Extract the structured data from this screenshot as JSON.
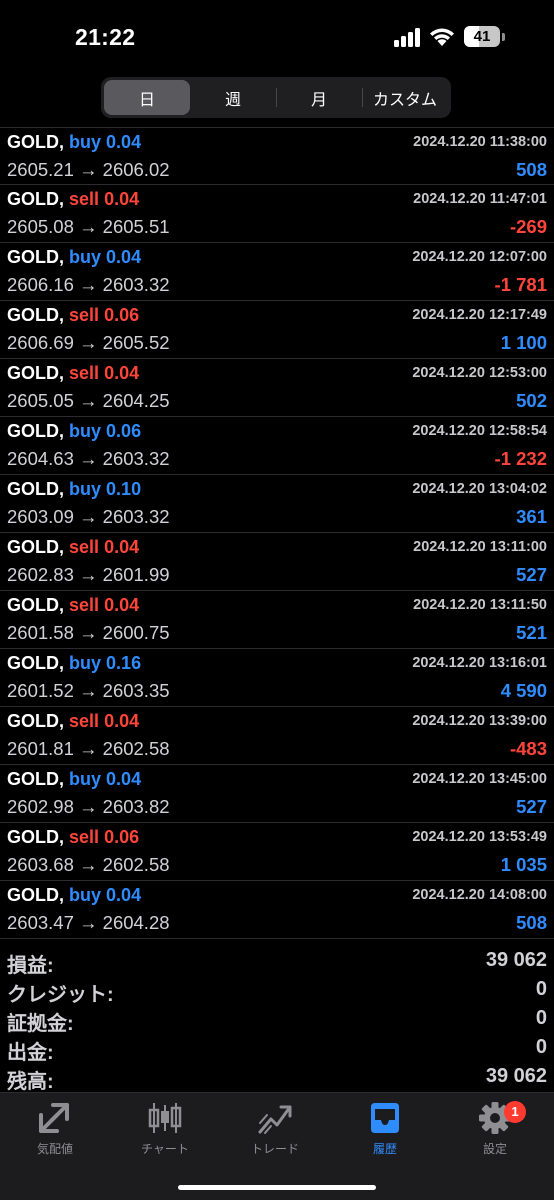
{
  "status": {
    "time": "21:22",
    "battery": "41",
    "battery_level": 0.41
  },
  "period_tabs": [
    {
      "label": "日",
      "active": true
    },
    {
      "label": "週",
      "active": false
    },
    {
      "label": "月",
      "active": false
    },
    {
      "label": "カスタム",
      "active": false
    }
  ],
  "deals": [
    {
      "symbol": "GOLD,",
      "side": "buy",
      "volume": "0.04",
      "prices": "2605.21 → 2606.02",
      "time": "2024.12.20 11:38:00",
      "profit": "508"
    },
    {
      "symbol": "GOLD,",
      "side": "sell",
      "volume": "0.04",
      "prices": "2605.08 → 2605.51",
      "time": "2024.12.20 11:47:01",
      "profit": "-269"
    },
    {
      "symbol": "GOLD,",
      "side": "buy",
      "volume": "0.04",
      "prices": "2606.16 → 2603.32",
      "time": "2024.12.20 12:07:00",
      "profit": "-1 781"
    },
    {
      "symbol": "GOLD,",
      "side": "sell",
      "volume": "0.06",
      "prices": "2606.69 → 2605.52",
      "time": "2024.12.20 12:17:49",
      "profit": "1 100"
    },
    {
      "symbol": "GOLD,",
      "side": "sell",
      "volume": "0.04",
      "prices": "2605.05 → 2604.25",
      "time": "2024.12.20 12:53:00",
      "profit": "502"
    },
    {
      "symbol": "GOLD,",
      "side": "buy",
      "volume": "0.06",
      "prices": "2604.63 → 2603.32",
      "time": "2024.12.20 12:58:54",
      "profit": "-1 232"
    },
    {
      "symbol": "GOLD,",
      "side": "buy",
      "volume": "0.10",
      "prices": "2603.09 → 2603.32",
      "time": "2024.12.20 13:04:02",
      "profit": "361"
    },
    {
      "symbol": "GOLD,",
      "side": "sell",
      "volume": "0.04",
      "prices": "2602.83 → 2601.99",
      "time": "2024.12.20 13:11:00",
      "profit": "527"
    },
    {
      "symbol": "GOLD,",
      "side": "sell",
      "volume": "0.04",
      "prices": "2601.58 → 2600.75",
      "time": "2024.12.20 13:11:50",
      "profit": "521"
    },
    {
      "symbol": "GOLD,",
      "side": "buy",
      "volume": "0.16",
      "prices": "2601.52 → 2603.35",
      "time": "2024.12.20 13:16:01",
      "profit": "4 590"
    },
    {
      "symbol": "GOLD,",
      "side": "sell",
      "volume": "0.04",
      "prices": "2601.81 → 2602.58",
      "time": "2024.12.20 13:39:00",
      "profit": "-483"
    },
    {
      "symbol": "GOLD,",
      "side": "buy",
      "volume": "0.04",
      "prices": "2602.98 → 2603.82",
      "time": "2024.12.20 13:45:00",
      "profit": "527"
    },
    {
      "symbol": "GOLD,",
      "side": "sell",
      "volume": "0.06",
      "prices": "2603.68 → 2602.58",
      "time": "2024.12.20 13:53:49",
      "profit": "1 035"
    },
    {
      "symbol": "GOLD,",
      "side": "buy",
      "volume": "0.04",
      "prices": "2603.47 → 2604.28",
      "time": "2024.12.20 14:08:00",
      "profit": "508"
    }
  ],
  "summary": [
    {
      "label": "損益:",
      "value": "39 062"
    },
    {
      "label": "クレジット:",
      "value": "0"
    },
    {
      "label": "証拠金:",
      "value": "0"
    },
    {
      "label": "出金:",
      "value": "0"
    },
    {
      "label": "残高:",
      "value": "39 062"
    }
  ],
  "tabbar": [
    {
      "label": "気配値",
      "icon": "quotes-arrows-icon",
      "active": false
    },
    {
      "label": "チャート",
      "icon": "candlestick-chart-icon",
      "active": false
    },
    {
      "label": "トレード",
      "icon": "trade-trend-icon",
      "active": false
    },
    {
      "label": "履歴",
      "icon": "history-inbox-icon",
      "active": true
    },
    {
      "label": "設定",
      "icon": "settings-gear-icon",
      "active": false,
      "badge": "1"
    }
  ],
  "colors": {
    "buy": "#2f8cff",
    "sell": "#ff453a",
    "active_tab": "#2f8cff",
    "inactive_tab": "#8e8e93"
  }
}
